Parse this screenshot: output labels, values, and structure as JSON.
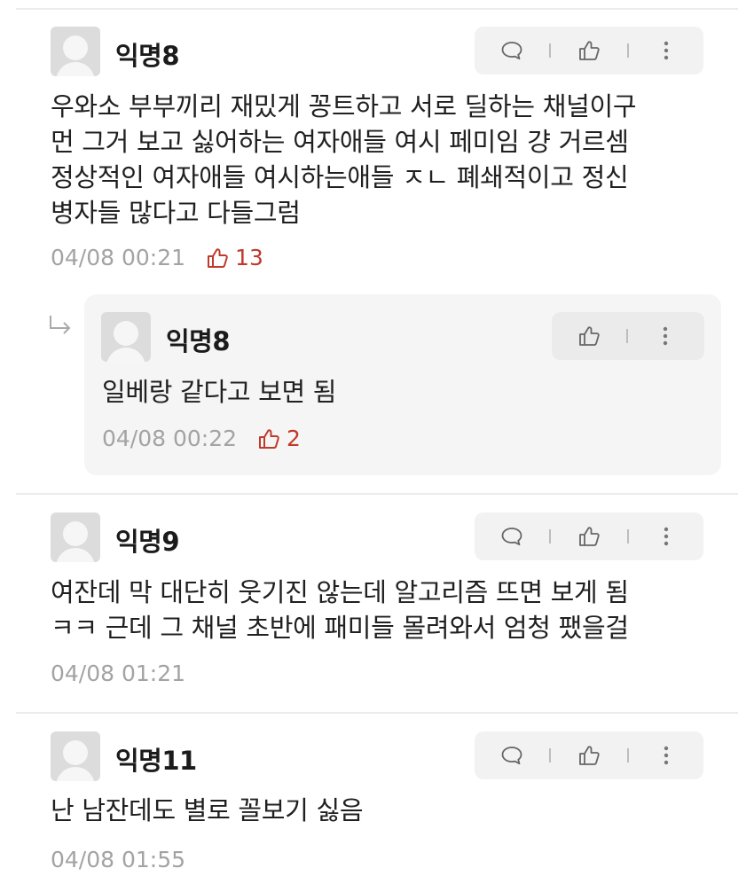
{
  "comments": [
    {
      "author": "익명8",
      "text": "우와소 부부끼리 재밌게 꽁트하고 서로 딜하는 채널이구\n먼 그거 보고 싫어하는 여자애들 여시 페미임 걍 거르셈\n정상적인 여자애들 여시하는애들 ㅈㄴ 폐쇄적이고 정신\n병자들 많다고 다들그럼",
      "timestamp": "04/08 00:21",
      "likes": "13",
      "reply": {
        "author": "익명8",
        "text": "일베랑 같다고 보면 됨",
        "timestamp": "04/08 00:22",
        "likes": "2"
      }
    },
    {
      "author": "익명9",
      "text": "여잔데 막 대단히 웃기진 않는데 알고리즘 뜨면 보게 됨\nㅋㅋ 근데 그 채널 초반에 패미들 몰려와서 엄청 팼을걸",
      "timestamp": "04/08 01:21"
    },
    {
      "author": "익명11",
      "text": "난 남잔데도 별로 꼴보기 싫음",
      "timestamp": "04/08 01:55"
    }
  ],
  "icons": {
    "reply": "speech-bubble-icon",
    "like": "thumbs-up-icon",
    "more": "more-vertical-icon",
    "reply_indicator": "reply-arrow-icon"
  },
  "colors": {
    "like_accent": "#c0392b",
    "meta_text": "#a3a3a3",
    "action_bg": "#f2f2f2"
  }
}
